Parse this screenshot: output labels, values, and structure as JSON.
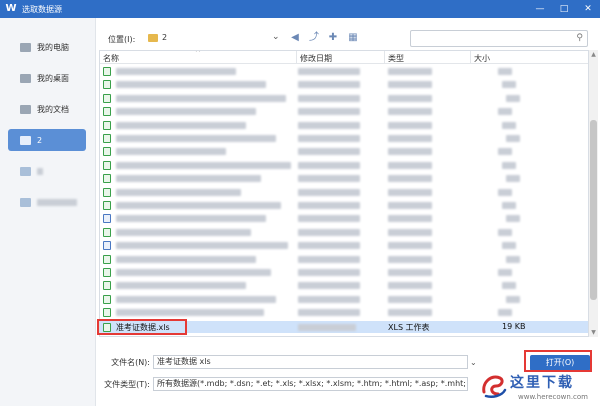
{
  "window": {
    "title": "选取数据源",
    "logo": "W",
    "minimize_glyph": "—",
    "maximize_glyph": "□",
    "close_glyph": "✕"
  },
  "sidebar": {
    "items": [
      {
        "label": "我的电脑",
        "icon": "computer-icon"
      },
      {
        "label": "我的桌面",
        "icon": "desktop-icon"
      },
      {
        "label": "我的文档",
        "icon": "documents-icon"
      },
      {
        "label": "2",
        "icon": "folder-icon",
        "active": true
      },
      {
        "label": "",
        "icon": "folder-icon"
      },
      {
        "label": "",
        "icon": "folder-icon"
      }
    ]
  },
  "toolbar": {
    "location_label": "位置(I):",
    "location_value": "2",
    "dropdown_glyph": "⌄",
    "back_glyph": "◀",
    "up_glyph": "⤴",
    "new_folder_glyph": "✚",
    "view_glyph": "▦"
  },
  "columns": {
    "name": "名称",
    "modified": "修改日期",
    "type": "类型",
    "size": "大小"
  },
  "selected_file": {
    "name": "准考证数据.xls",
    "type": "XLS 工作表",
    "size": "19 KB"
  },
  "form": {
    "filename_label": "文件名(N):",
    "filename_value": "准考证数据 xls",
    "filetype_label": "文件类型(T):",
    "filetype_value": "所有数据源(*.mdb; *.dsn; *.et; *.xls; *.xlsx; *.xlsm; *.htm; *.html; *.asp; *.mht; *.mhtml; *.rt",
    "open_button": "打开(O)"
  },
  "watermark": {
    "title": "这里下载",
    "url": "www.herecown.com"
  }
}
